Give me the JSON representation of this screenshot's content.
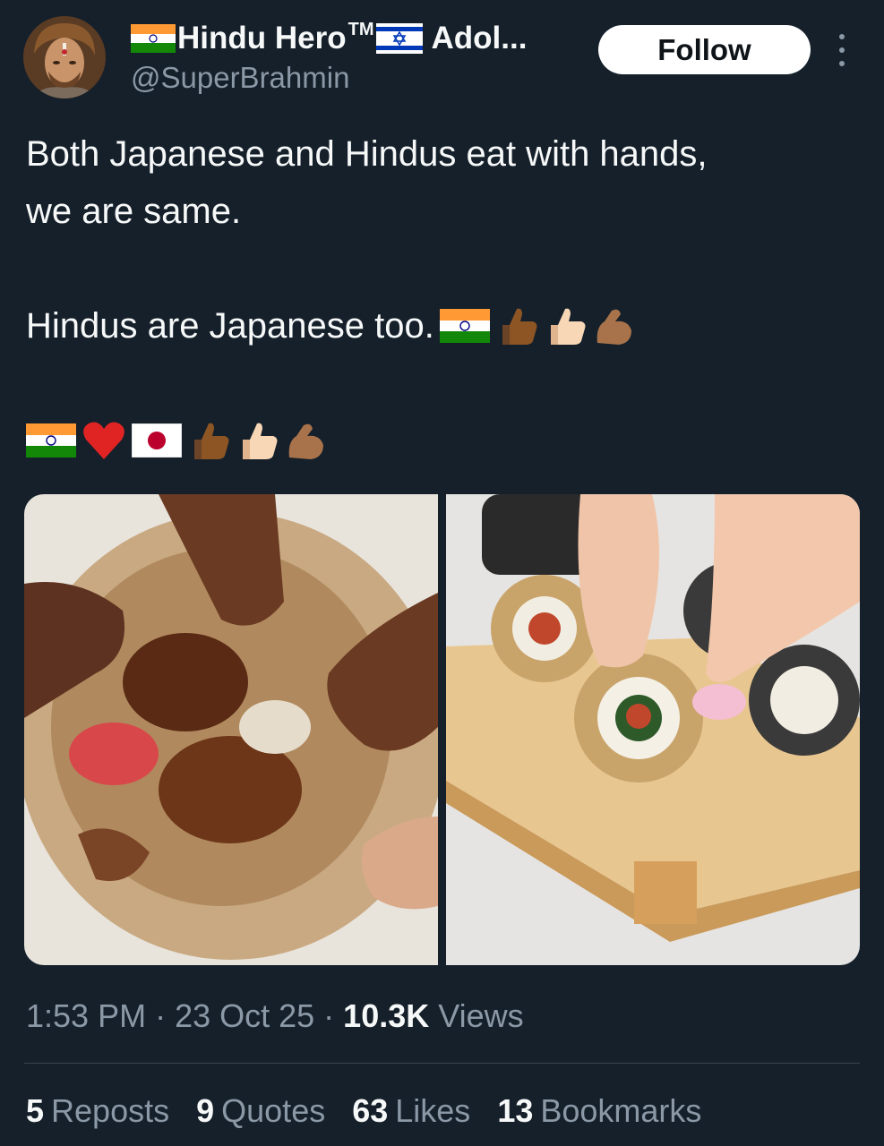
{
  "author": {
    "name_part1": "Hindu Hero",
    "trademark": "TM",
    "name_part2": "Adol...",
    "handle": "@SuperBrahmin"
  },
  "follow_label": "Follow",
  "text": {
    "line1": "Both Japanese and Hindus eat with hands,",
    "line2": "we are same.",
    "line3": "Hindus are Japanese too."
  },
  "emoji": {
    "line3": [
      "india-flag",
      "thumbs-up-dark",
      "thumbs-up-light",
      "flexed-biceps"
    ],
    "line4": [
      "india-flag",
      "red-heart",
      "japan-flag",
      "thumbs-up-dark",
      "thumbs-up-light",
      "flexed-biceps"
    ]
  },
  "meta": {
    "time": "1:53 PM",
    "sep1": " · ",
    "date": "23 Oct 25",
    "sep2": " · ",
    "views_count": "10.3K",
    "views_label": " Views"
  },
  "stats": {
    "reposts_count": "5",
    "reposts_label": "Reposts",
    "quotes_count": "9",
    "quotes_label": "Quotes",
    "likes_count": "63",
    "likes_label": "Likes",
    "bookmarks_count": "13",
    "bookmarks_label": "Bookmarks"
  },
  "colors": {
    "background": "#15202b",
    "primary_text": "#f7f9f9",
    "secondary_text": "#8b98a5",
    "follow_bg": "#ffffff"
  }
}
